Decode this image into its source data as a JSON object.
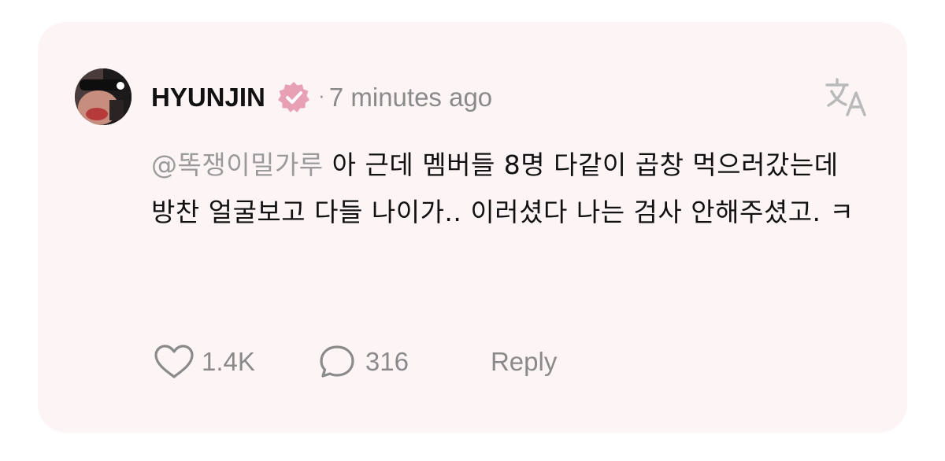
{
  "post": {
    "username": "HYUNJIN",
    "separator": "·",
    "timestamp": "7 minutes ago",
    "verified": true,
    "mention": "@똑쟁이밀가루",
    "message": " 아 근데 멤버들 8명 다같이 곱창 먹으러갔는데 방찬 얼굴보고 다들 나이가.. 이러셨다 나는 검사 안해주셨고. ㅋ"
  },
  "actions": {
    "like_count": "1.4K",
    "comment_count": "316",
    "reply_label": "Reply"
  },
  "icons": {
    "avatar": "avatar",
    "badge": "verified-badge-icon",
    "translate": "translate-icon",
    "like": "heart-icon",
    "comment": "comment-bubble-icon"
  },
  "colors": {
    "card_background": "#fdf4f6",
    "badge": "#e8a0b4",
    "muted_text": "#8a8a8a",
    "primary_text": "#111111"
  }
}
